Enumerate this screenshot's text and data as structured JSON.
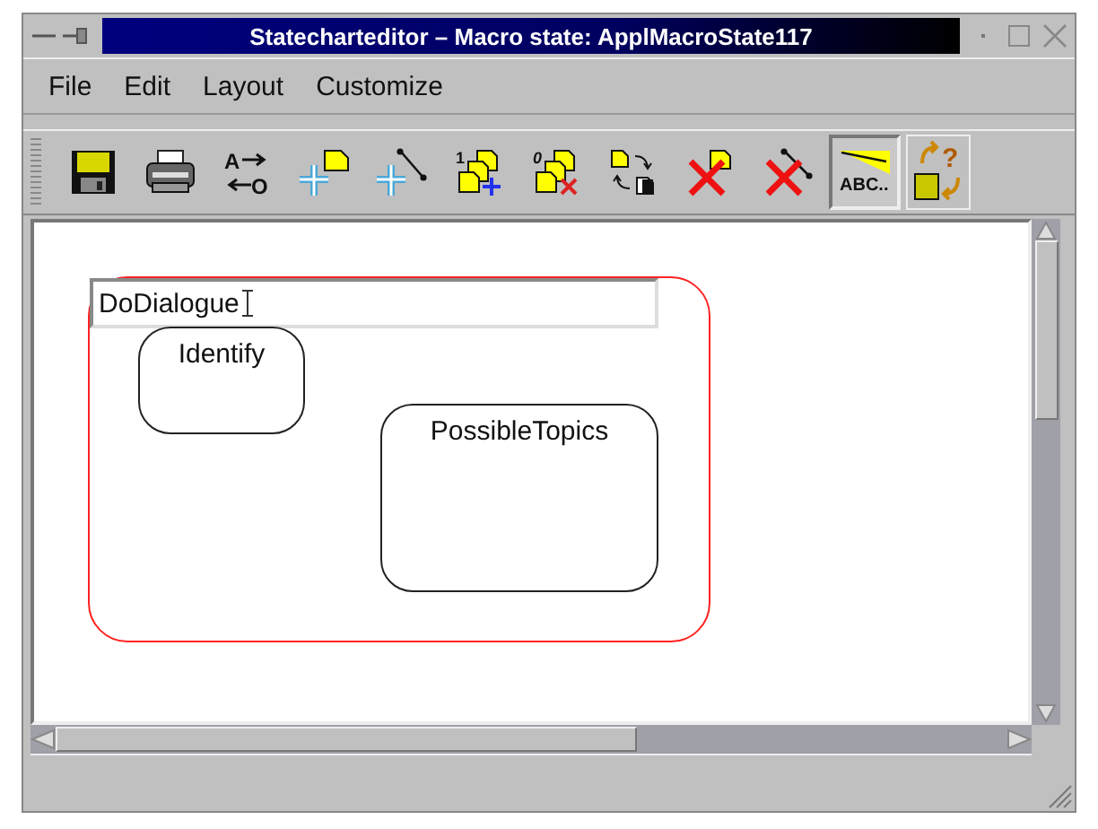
{
  "window": {
    "title": "Statecharteditor –  Macro state:  ApplMacroState117"
  },
  "menu": [
    "File",
    "Edit",
    "Layout",
    "Customize"
  ],
  "toolbar": [
    {
      "kind": "save",
      "pressed": false
    },
    {
      "kind": "print",
      "pressed": false
    },
    {
      "kind": "rename",
      "text_top": "A",
      "text_bottom": "O",
      "pressed": false
    },
    {
      "kind": "add-state",
      "pressed": false
    },
    {
      "kind": "add-transition",
      "pressed": false
    },
    {
      "kind": "add-many",
      "text": "1",
      "pressed": false
    },
    {
      "kind": "delete-many",
      "text": "0",
      "pressed": false
    },
    {
      "kind": "swap",
      "pressed": false
    },
    {
      "kind": "delete-state",
      "pressed": false
    },
    {
      "kind": "delete-transition",
      "pressed": false
    },
    {
      "kind": "label",
      "text": "ABC..",
      "pressed": true
    },
    {
      "kind": "help",
      "text": "?",
      "pressed": false
    }
  ],
  "diagram": {
    "states": [
      {
        "name": "DoDialogue",
        "selected": true,
        "editing": true,
        "children": [
          {
            "name": "Identify",
            "selected": false,
            "editing": false
          },
          {
            "name": "PossibleTopics",
            "selected": false,
            "editing": false
          }
        ]
      }
    ]
  }
}
